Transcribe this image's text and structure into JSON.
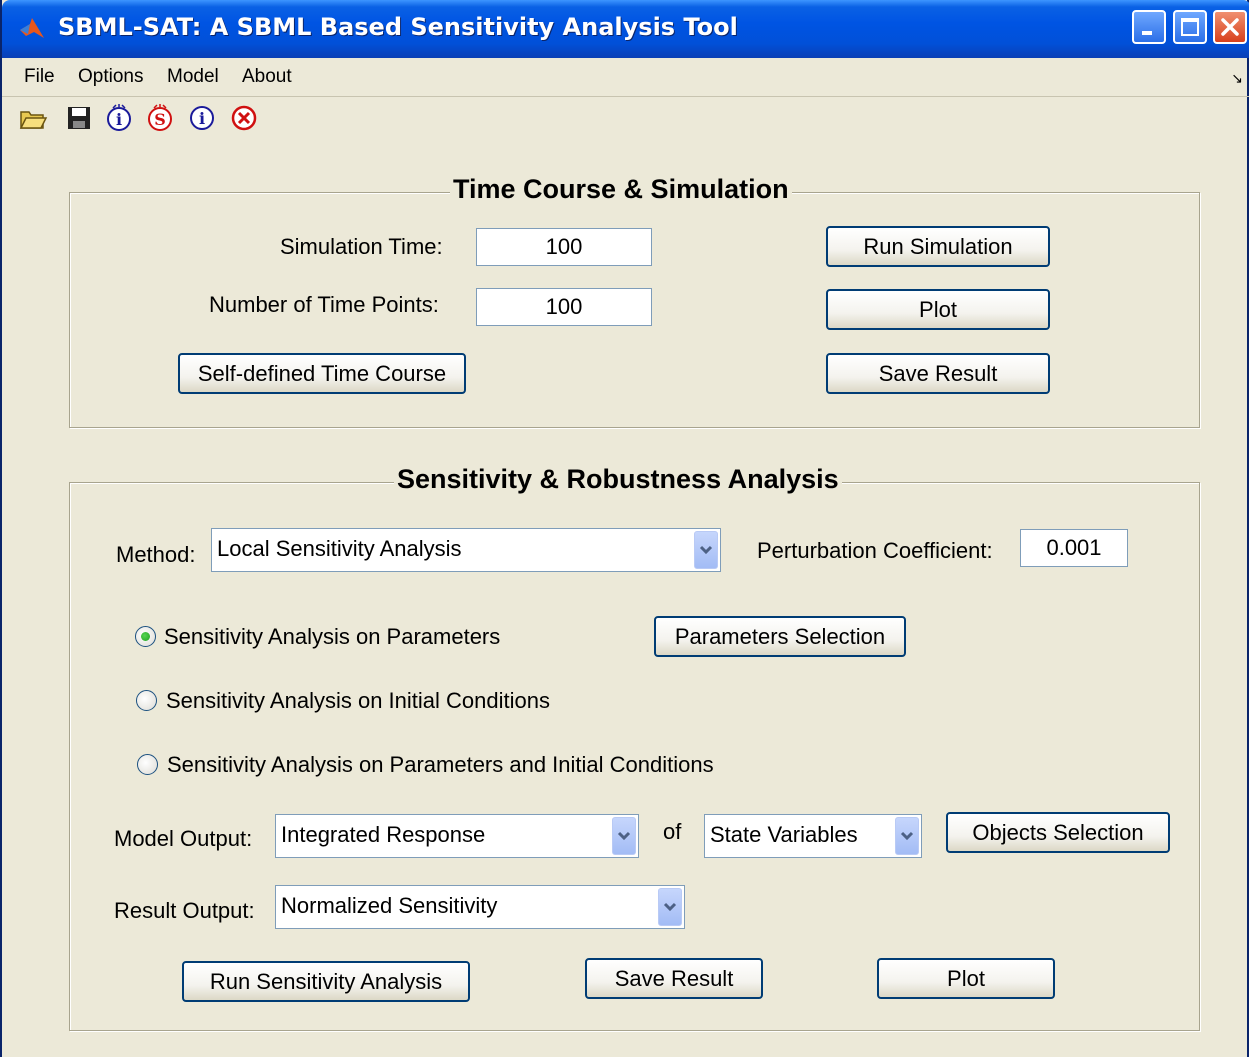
{
  "window": {
    "title": "SBML-SAT: A SBML Based Sensitivity Analysis Tool"
  },
  "menu": {
    "items": [
      "File",
      "Options",
      "Model",
      "About"
    ]
  },
  "toolbar": {
    "tools": [
      "open-folder-icon",
      "save-disk-icon",
      "info-i-icon",
      "info-s-icon",
      "about-icon",
      "exit-icon"
    ]
  },
  "time_course": {
    "title": "Time Course & Simulation",
    "simulation_time_label": "Simulation Time:",
    "simulation_time_value": "100",
    "time_points_label": "Number of Time Points:",
    "time_points_value": "100",
    "self_defined_button": "Self-defined Time Course",
    "run_button": "Run Simulation",
    "plot_button": "Plot",
    "save_button": "Save Result"
  },
  "sensitivity": {
    "title": "Sensitivity & Robustness Analysis",
    "method_label": "Method:",
    "method_value": "Local Sensitivity Analysis",
    "perturbation_label": "Perturbation Coefficient:",
    "perturbation_value": "0.001",
    "radio_options": [
      {
        "label": "Sensitivity Analysis on Parameters",
        "checked": true
      },
      {
        "label": "Sensitivity Analysis on Initial Conditions",
        "checked": false
      },
      {
        "label": "Sensitivity Analysis on Parameters and Initial Conditions",
        "checked": false
      }
    ],
    "parameters_selection_button": "Parameters Selection",
    "model_output_label": "Model Output:",
    "model_output_value": "Integrated Response",
    "of_label": "of",
    "state_vars_value": "State Variables",
    "objects_selection_button": "Objects Selection",
    "result_output_label": "Result Output:",
    "result_output_value": "Normalized Sensitivity",
    "run_button": "Run Sensitivity Analysis",
    "save_button": "Save Result",
    "plot_button": "Plot"
  },
  "colors": {
    "titlebar": "#0054e3",
    "window_bg": "#ece9d8",
    "button_border": "#003c74"
  }
}
